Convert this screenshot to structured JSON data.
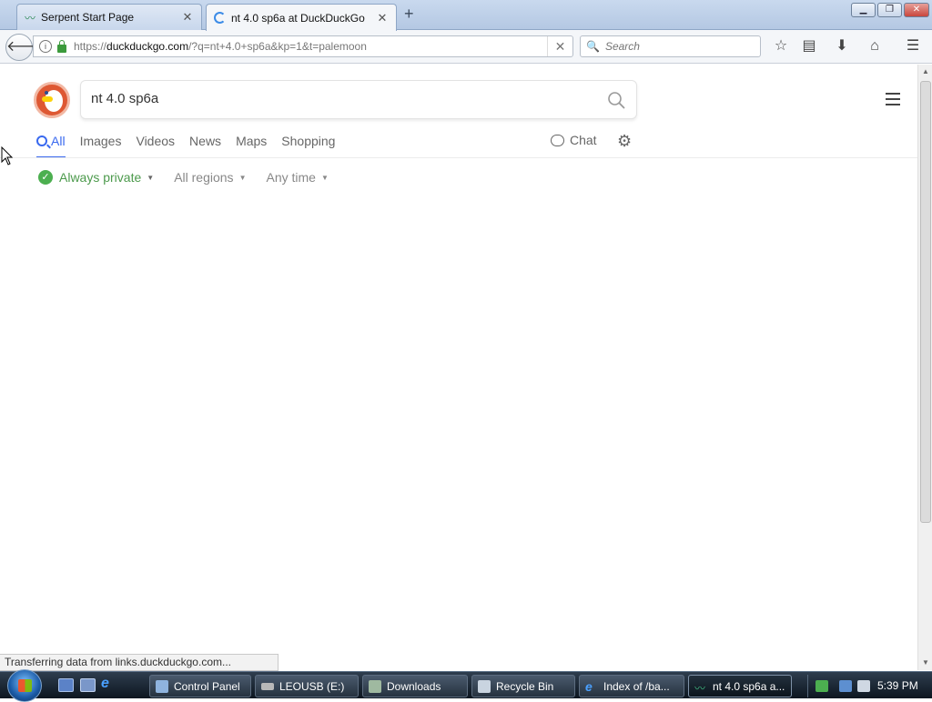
{
  "browser": {
    "tabs": [
      {
        "title": "Serpent Start Page",
        "active": false
      },
      {
        "title": "nt 4.0 sp6a at DuckDuckGo",
        "active": true
      }
    ],
    "url": {
      "scheme": "https://",
      "host": "duckduckgo.com",
      "rest": "/?q=nt+4.0+sp6a&kp=1&t=palemoon"
    },
    "search_placeholder": "Search",
    "status": "Transferring data from links.duckduckgo.com..."
  },
  "page": {
    "query": "nt 4.0 sp6a",
    "nav_tabs": [
      "All",
      "Images",
      "Videos",
      "News",
      "Maps",
      "Shopping"
    ],
    "active_tab": "All",
    "chat_label": "Chat",
    "filters": [
      "Always private",
      "All regions",
      "Any time"
    ],
    "colors": {
      "accent": "#3969ef",
      "private_green": "#4c9a4c",
      "logo": "#de5833"
    }
  },
  "taskbar": {
    "items": [
      {
        "label": "Control Panel",
        "active": false
      },
      {
        "label": "LEOUSB (E:)",
        "active": false
      },
      {
        "label": "Downloads",
        "active": false
      },
      {
        "label": "Recycle Bin",
        "active": false
      },
      {
        "label": "Index of /ba...",
        "active": false
      },
      {
        "label": "nt 4.0 sp6a a...",
        "active": true
      }
    ],
    "clock": "5:39 PM"
  }
}
